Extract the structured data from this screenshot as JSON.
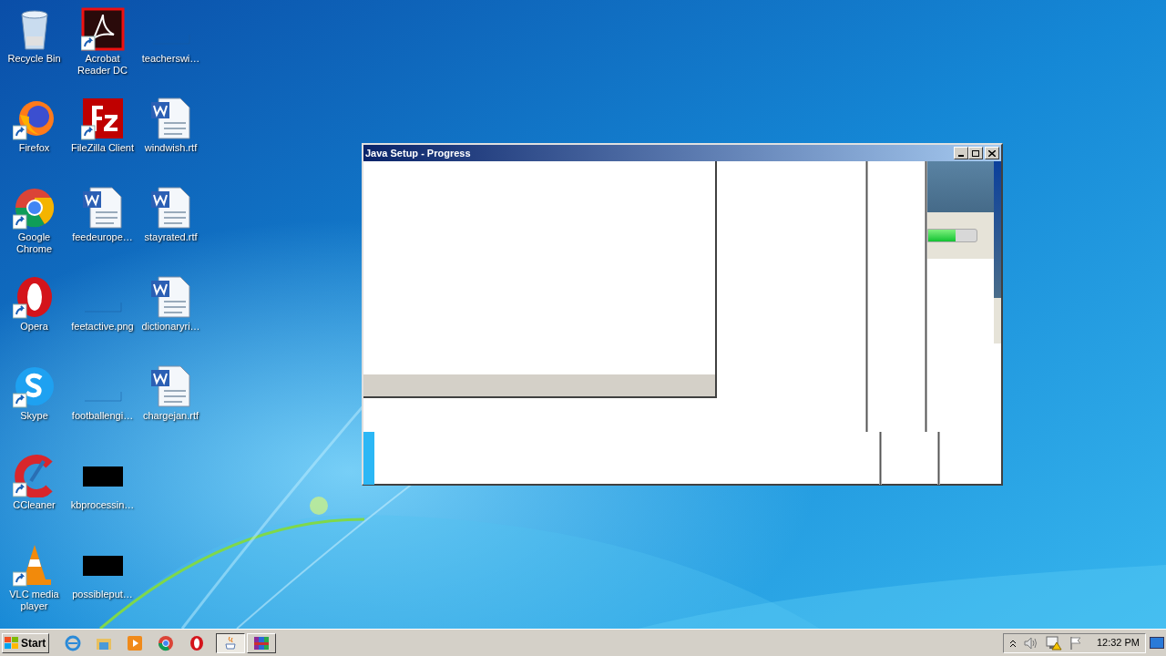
{
  "desktop": {
    "icons": [
      {
        "label": "Recycle Bin",
        "kind": "recycle",
        "shortcut": false
      },
      {
        "label": "Firefox",
        "kind": "firefox",
        "shortcut": true
      },
      {
        "label": "Google Chrome",
        "kind": "chrome",
        "shortcut": true
      },
      {
        "label": "Opera",
        "kind": "opera",
        "shortcut": true
      },
      {
        "label": "Skype",
        "kind": "skype",
        "shortcut": true
      },
      {
        "label": "CCleaner",
        "kind": "ccleaner",
        "shortcut": true
      },
      {
        "label": "VLC media player",
        "kind": "vlc",
        "shortcut": true
      },
      {
        "label": "Acrobat Reader DC",
        "kind": "acrobat",
        "shortcut": true
      },
      {
        "label": "FileZilla Client",
        "kind": "filezilla",
        "shortcut": true
      },
      {
        "label": "feedeurope…",
        "kind": "word",
        "shortcut": false
      },
      {
        "label": "feetactive.png",
        "kind": "blank",
        "shortcut": false
      },
      {
        "label": "footballengi…",
        "kind": "blank",
        "shortcut": false
      },
      {
        "label": "kbprocessin…",
        "kind": "black",
        "shortcut": false
      },
      {
        "label": "possibleput…",
        "kind": "black",
        "shortcut": false
      },
      {
        "label": "teacherswi…",
        "kind": "blank",
        "shortcut": false
      },
      {
        "label": "windwish.rtf",
        "kind": "word",
        "shortcut": false
      },
      {
        "label": "stayrated.rtf",
        "kind": "word",
        "shortcut": false
      },
      {
        "label": "dictionaryri…",
        "kind": "word",
        "shortcut": false
      },
      {
        "label": "chargejan.rtf",
        "kind": "word",
        "shortcut": false
      }
    ]
  },
  "window": {
    "title": "Java Setup - Progress",
    "progress": {
      "level": 0.57
    }
  },
  "taskbar": {
    "start": "Start",
    "quick_launch": [
      {
        "kind": "ie"
      },
      {
        "kind": "explorer"
      },
      {
        "kind": "media"
      },
      {
        "kind": "chrome"
      },
      {
        "kind": "opera"
      }
    ],
    "tasks": [
      {
        "kind": "java",
        "selected": true
      },
      {
        "kind": "winrar",
        "selected": false
      }
    ],
    "tray": {
      "time": "12:32 PM"
    }
  }
}
